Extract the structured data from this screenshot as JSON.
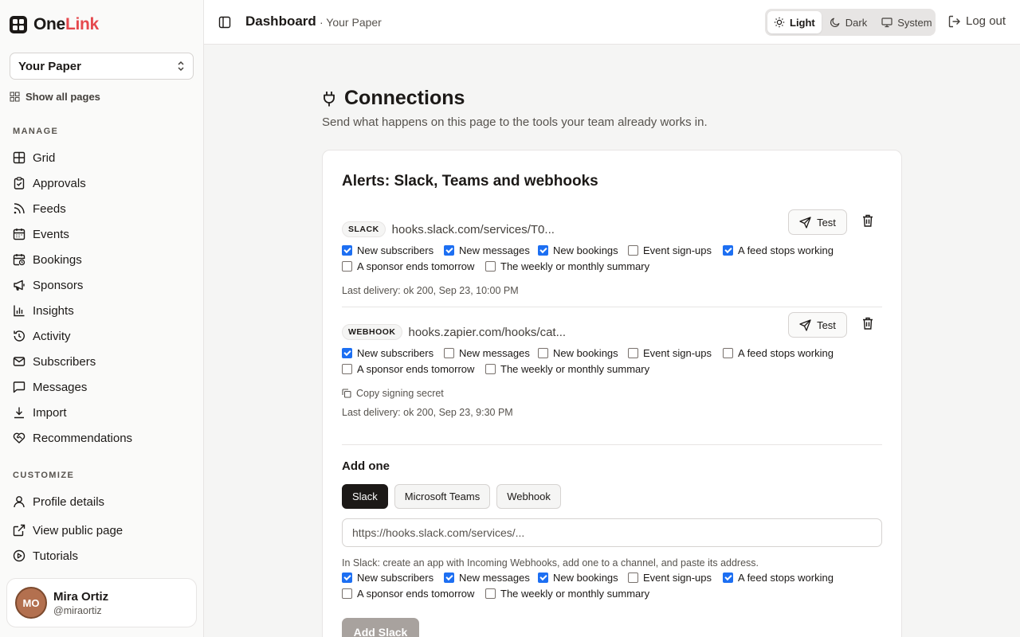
{
  "brand": {
    "name_part1": "One",
    "name_part2": "Link",
    "accent": "#e5484d"
  },
  "sidebar": {
    "page_select": "Your Paper",
    "show_all": "Show all pages",
    "manage_label": "MANAGE",
    "manage_items": [
      {
        "label": "Grid",
        "icon": "grid-icon"
      },
      {
        "label": "Approvals",
        "icon": "clipboard-check-icon"
      },
      {
        "label": "Feeds",
        "icon": "rss-icon"
      },
      {
        "label": "Events",
        "icon": "calendar-icon"
      },
      {
        "label": "Bookings",
        "icon": "calendar-clock-icon"
      },
      {
        "label": "Sponsors",
        "icon": "megaphone-icon"
      },
      {
        "label": "Insights",
        "icon": "bar-chart-icon"
      },
      {
        "label": "Activity",
        "icon": "history-icon"
      },
      {
        "label": "Subscribers",
        "icon": "mail-icon"
      },
      {
        "label": "Messages",
        "icon": "message-icon"
      },
      {
        "label": "Import",
        "icon": "download-icon"
      },
      {
        "label": "Recommendations",
        "icon": "heart-handshake-icon"
      }
    ],
    "customize_label": "CUSTOMIZE",
    "customize_items": [
      {
        "label": "Profile details",
        "icon": "user-icon"
      },
      {
        "label": "View public page",
        "icon": "external-link-icon"
      },
      {
        "label": "Tutorials",
        "icon": "play-circle-icon"
      }
    ],
    "user": {
      "initials": "MO",
      "name": "Mira Ortiz",
      "handle": "@miraortiz"
    }
  },
  "header": {
    "title": "Dashboard",
    "subtitle": "· Your Paper",
    "theme": {
      "light": "Light",
      "dark": "Dark",
      "system": "System",
      "selected": "Light"
    },
    "logout": "Log out"
  },
  "main": {
    "title": "Connections",
    "subtitle": "Send what happens on this page to the tools your team already works in.",
    "card_title": "Alerts: Slack, Teams and webhooks",
    "event_labels": [
      "New subscribers",
      "New messages",
      "New bookings",
      "Event sign-ups",
      "A feed stops working",
      "A sponsor ends tomorrow",
      "The weekly or monthly summary"
    ],
    "hooks": [
      {
        "kind": "SLACK",
        "url": "hooks.slack.com/services/T0...",
        "test_label": "Test",
        "checked": [
          true,
          true,
          true,
          false,
          true,
          false,
          false
        ],
        "delivery": "Last delivery: ok 200, Sep 23, 10:00 PM"
      },
      {
        "kind": "WEBHOOK",
        "url": "hooks.zapier.com/hooks/cat...",
        "test_label": "Test",
        "checked": [
          true,
          false,
          false,
          false,
          false,
          false,
          false
        ],
        "copy_secret": "Copy signing secret",
        "delivery": "Last delivery: ok 200, Sep 23, 9:30 PM"
      }
    ],
    "add": {
      "title": "Add one",
      "tabs": [
        "Slack",
        "Microsoft Teams",
        "Webhook"
      ],
      "selected_tab": "Slack",
      "placeholder": "https://hooks.slack.com/services/...",
      "help": "In Slack: create an app with Incoming Webhooks, add one to a channel, and paste its address.",
      "checked": [
        true,
        true,
        true,
        false,
        true,
        false,
        false
      ],
      "button": "Add Slack"
    }
  }
}
